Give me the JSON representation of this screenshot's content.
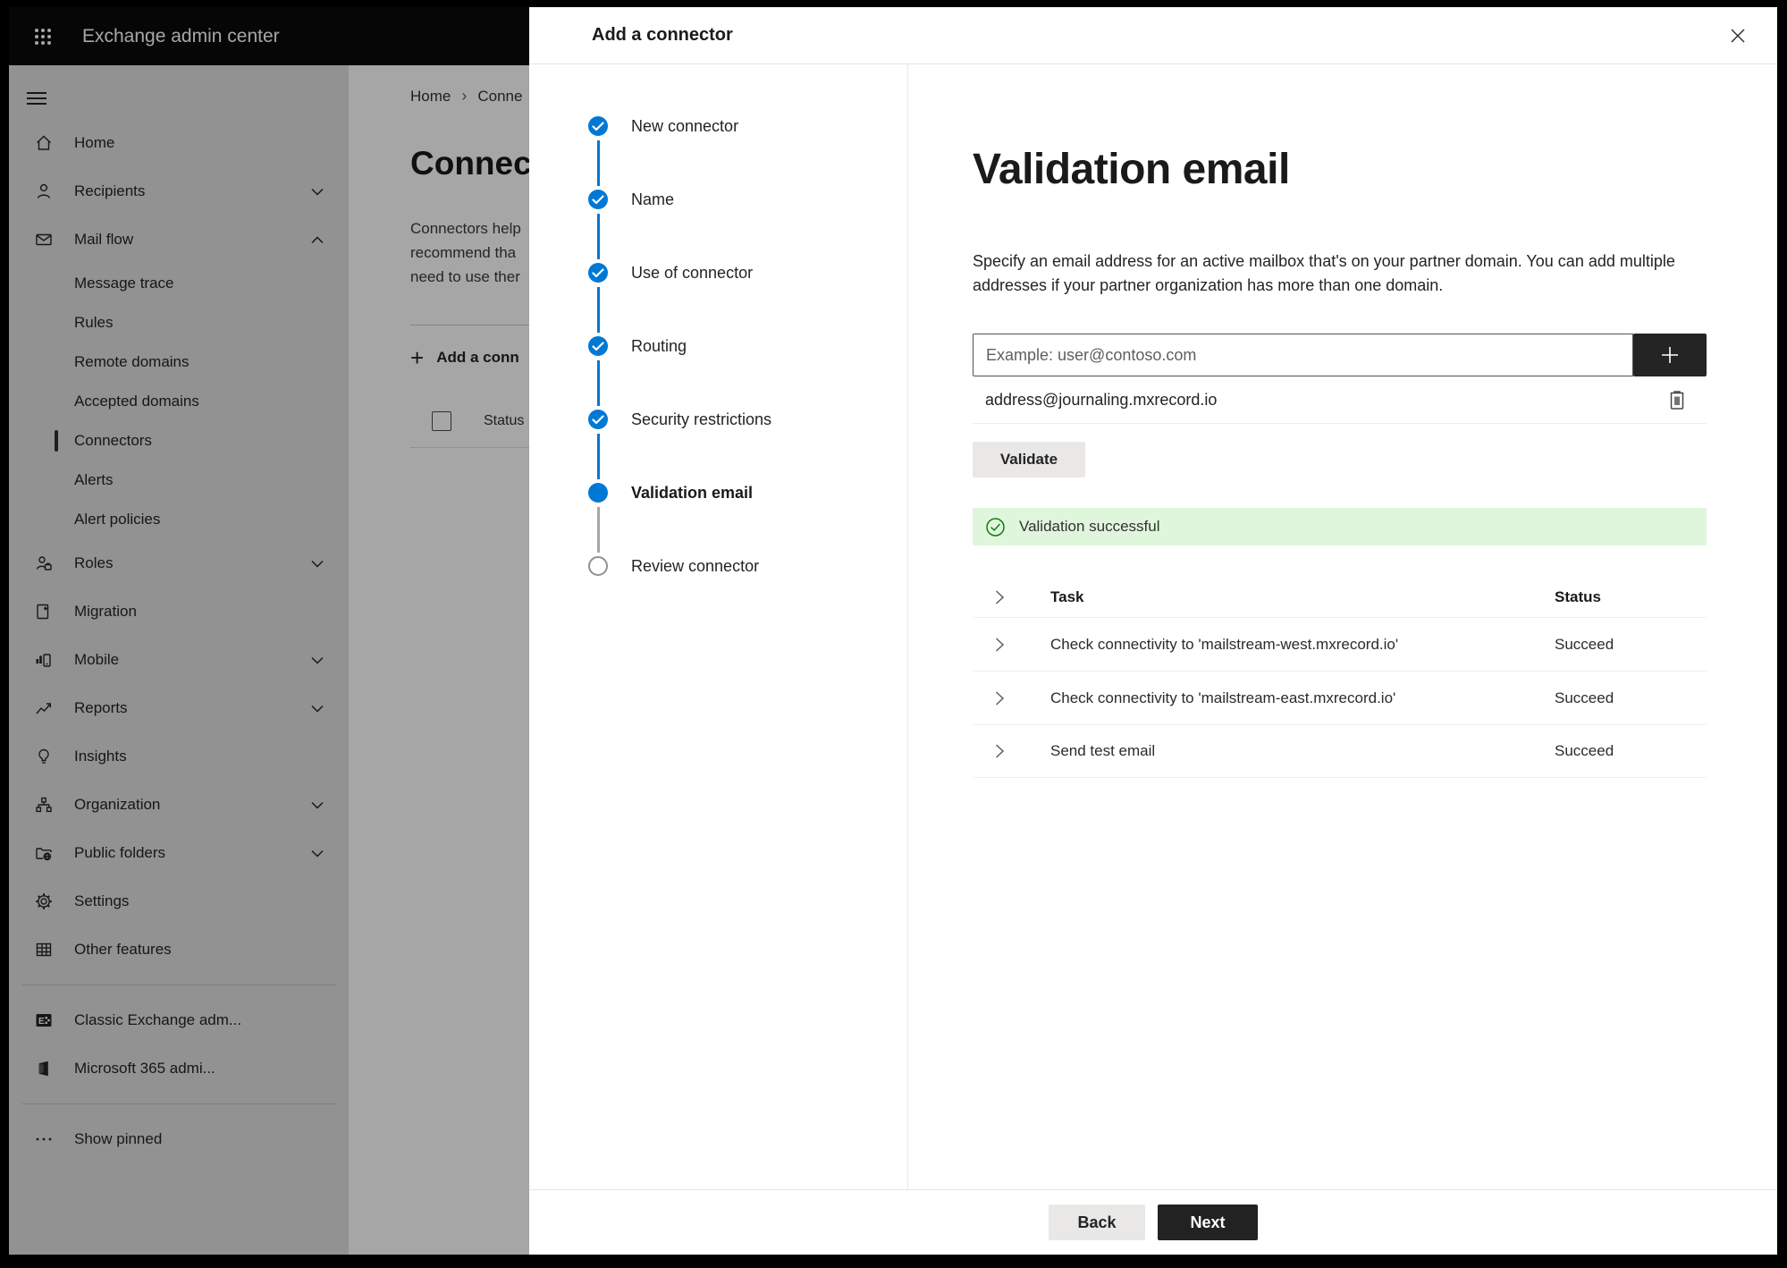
{
  "topbar": {
    "title": "Exchange admin center"
  },
  "sidebar": {
    "items": [
      {
        "label": "Home"
      },
      {
        "label": "Recipients"
      },
      {
        "label": "Mail flow"
      },
      {
        "label": "Message trace"
      },
      {
        "label": "Rules"
      },
      {
        "label": "Remote domains"
      },
      {
        "label": "Accepted domains"
      },
      {
        "label": "Connectors"
      },
      {
        "label": "Alerts"
      },
      {
        "label": "Alert policies"
      },
      {
        "label": "Roles"
      },
      {
        "label": "Migration"
      },
      {
        "label": "Mobile"
      },
      {
        "label": "Reports"
      },
      {
        "label": "Insights"
      },
      {
        "label": "Organization"
      },
      {
        "label": "Public folders"
      },
      {
        "label": "Settings"
      },
      {
        "label": "Other features"
      },
      {
        "label": "Classic Exchange adm..."
      },
      {
        "label": "Microsoft 365 admi..."
      },
      {
        "label": "Show pinned"
      }
    ]
  },
  "background_page": {
    "breadcrumb": {
      "home": "Home",
      "current": "Conne"
    },
    "heading": "Connec",
    "paragraph_lines": [
      "Connectors help",
      "recommend tha",
      "need to use ther"
    ],
    "add_button_label": "Add a conn",
    "table_status_header": "Status"
  },
  "wizard": {
    "title": "Add a connector",
    "steps": [
      {
        "label": "New connector",
        "state": "complete"
      },
      {
        "label": "Name",
        "state": "complete"
      },
      {
        "label": "Use of connector",
        "state": "complete"
      },
      {
        "label": "Routing",
        "state": "complete"
      },
      {
        "label": "Security restrictions",
        "state": "complete"
      },
      {
        "label": "Validation email",
        "state": "active"
      },
      {
        "label": "Review connector",
        "state": "upcoming"
      }
    ]
  },
  "validation": {
    "heading": "Validation email",
    "description": "Specify an email address for an active mailbox that's on your partner domain. You can add multiple addresses if your partner organization has more than one domain.",
    "input_placeholder": "Example: user@contoso.com",
    "added_address": "address@journaling.mxrecord.io",
    "validate_button": "Validate",
    "banner_message": "Validation successful",
    "table": {
      "headers": {
        "task": "Task",
        "status": "Status"
      },
      "rows": [
        {
          "task": "Check connectivity to 'mailstream-west.mxrecord.io'",
          "status": "Succeed"
        },
        {
          "task": "Check connectivity to 'mailstream-east.mxrecord.io'",
          "status": "Succeed"
        },
        {
          "task": "Send test email",
          "status": "Succeed"
        }
      ]
    }
  },
  "footer": {
    "back": "Back",
    "next": "Next"
  },
  "colors": {
    "accent_blue": "#0078d4",
    "success_bg": "#dff6dd",
    "success_green": "#107c10",
    "topbar_bg": "#0a0a0a"
  }
}
